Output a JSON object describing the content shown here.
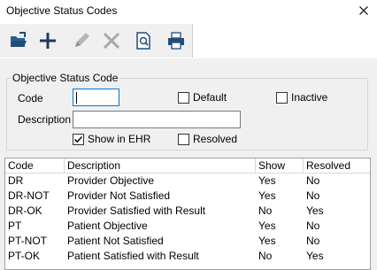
{
  "window": {
    "title": "Objective Status Codes",
    "close_icon": "close-icon"
  },
  "toolbar": {
    "buttons": [
      {
        "name": "open-button",
        "icon": "open-folder-icon"
      },
      {
        "name": "add-button",
        "icon": "plus-icon"
      },
      {
        "name": "edit-button",
        "icon": "pencil-icon",
        "disabled": true
      },
      {
        "name": "delete-button",
        "icon": "x-icon",
        "disabled": true
      },
      {
        "name": "preview-button",
        "icon": "magnify-document-icon"
      },
      {
        "name": "print-button",
        "icon": "printer-icon"
      }
    ]
  },
  "form": {
    "group_title": "Objective Status Code",
    "code_label": "Code",
    "code_value": "",
    "description_label": "Description",
    "description_value": "",
    "default_label": "Default",
    "default_checked": false,
    "inactive_label": "Inactive",
    "inactive_checked": false,
    "show_in_ehr_label": "Show in EHR",
    "show_in_ehr_checked": true,
    "resolved_label": "Resolved",
    "resolved_checked": false
  },
  "grid": {
    "columns": [
      "Code",
      "Description",
      "Show",
      "Resolved"
    ],
    "rows": [
      [
        "DR",
        "Provider Objective",
        "Yes",
        "No"
      ],
      [
        "DR-NOT",
        "Provider Not Satisfied",
        "Yes",
        "No"
      ],
      [
        "DR-OK",
        "Provider Satisfied with Result",
        "No",
        "Yes"
      ],
      [
        "PT",
        "Patient Objective",
        "Yes",
        "No"
      ],
      [
        "PT-NOT",
        "Patient Not Satisfied",
        "Yes",
        "No"
      ],
      [
        "PT-OK",
        "Patient Satisfied with Result",
        "No",
        "Yes"
      ]
    ]
  },
  "colors": {
    "focus_border": "#0078d7",
    "toolbar_blue": "#1f4e79",
    "disabled_gray": "#a9a9a9"
  }
}
